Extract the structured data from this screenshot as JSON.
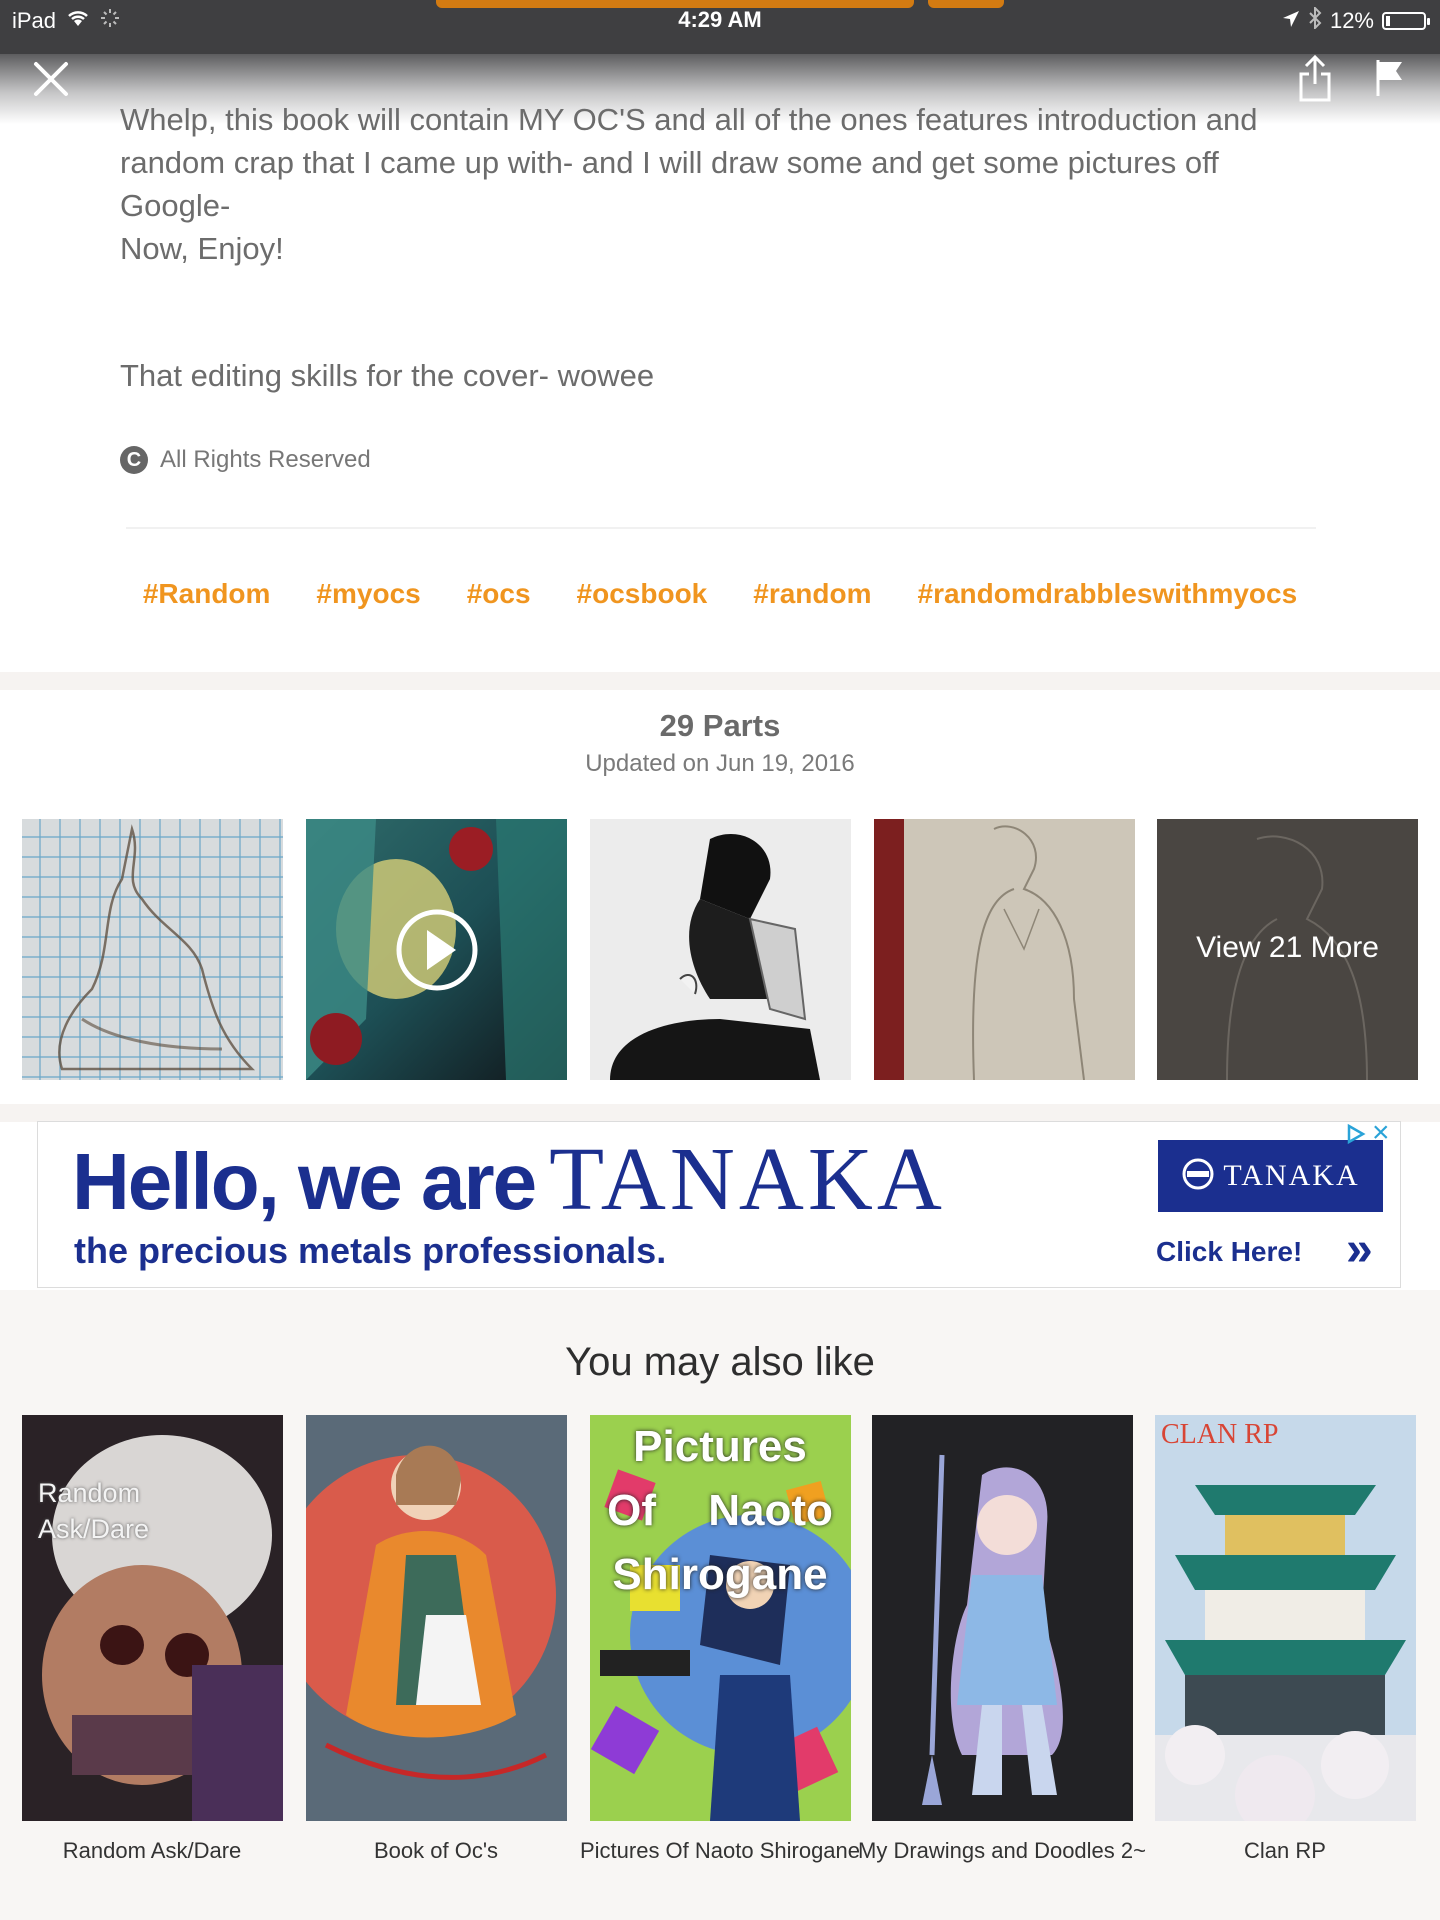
{
  "status_bar": {
    "device": "iPad",
    "time": "4:29 AM",
    "battery": "12%",
    "battery_level": 0.12
  },
  "description": {
    "paragraphs": [
      "Whelp, this book will contain MY OC'S and all of the ones features introduction and random crap that I came up with- and I will draw some and get some pictures off Google-",
      "Now, Enjoy!",
      "That editing skills for the cover- wowee"
    ]
  },
  "copyright": {
    "icon": "C",
    "label": "All Rights Reserved"
  },
  "tags": [
    "#Random",
    "#myocs",
    "#ocs",
    "#ocsbook",
    "#random",
    "#randomdrabbleswithmyocs"
  ],
  "parts": {
    "count_label": "29 Parts",
    "updated_label": "Updated on Jun 19, 2016",
    "view_more_label": "View 21 More"
  },
  "ad": {
    "headline_prefix": "Hello, we are",
    "brand": "TANAKA",
    "tagline": "the precious metals professionals.",
    "logo_text": "TANAKA",
    "cta": "Click Here!",
    "chevrons": "»",
    "close": "×"
  },
  "recommendations": {
    "heading": "You may also like",
    "items": [
      {
        "title": "Random Ask/Dare",
        "cover_text": "Random Ask/Dare"
      },
      {
        "title": "Book of Oc's"
      },
      {
        "title": "Pictures Of Naoto Shirogane",
        "cover_text": "Pictures Of Naoto Shirogane"
      },
      {
        "title": "My Drawings and Doodles 2~"
      },
      {
        "title": "Clan RP",
        "cover_text": "CLAN RP"
      }
    ]
  },
  "colors": {
    "accent_orange": "#f0951f",
    "status_bar": "#3f3f41",
    "tanaka_blue": "#1b2f8f"
  }
}
